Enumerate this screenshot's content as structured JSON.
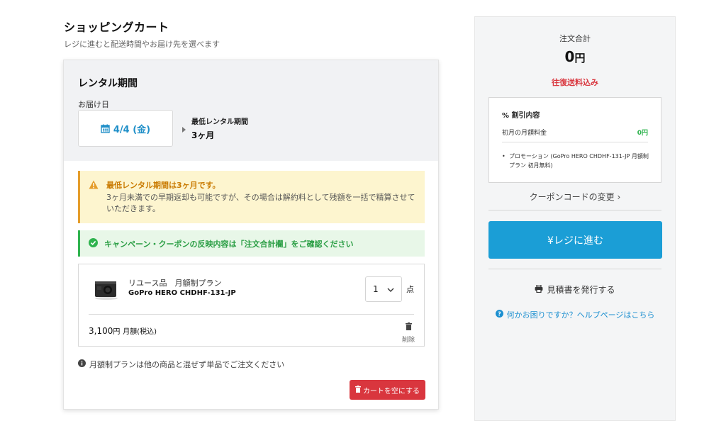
{
  "header": {
    "title": "ショッピングカート",
    "subtitle": "レジに進むと配送時間やお届け先を選べます"
  },
  "rental": {
    "title": "レンタル期間",
    "delivery_label": "お届け日",
    "delivery_date": "4/4 (金)",
    "min_period_label": "最低レンタル期間",
    "min_period_value": "3ヶ月"
  },
  "warning": {
    "title": "最低レンタル期間は3ヶ月です。",
    "body": "3ヶ月未満での早期返却も可能ですが、その場合は解約料として残額を一括で精算させていただきます。",
    "color": "#e59d2a"
  },
  "campaign": {
    "text": "キャンペーン・クーポンの反映内容は「注文合計欄」をご確認ください",
    "color": "#2fb34e"
  },
  "product": {
    "kind": "リユース品　月額制プラン",
    "name": "GoPro HERO CHDHF-131-JP",
    "quantity": "1",
    "quantity_unit": "点",
    "price": "3,100",
    "price_currency": "円",
    "price_suffix": "月額(税込)",
    "delete_label": "削除"
  },
  "notice": {
    "text": "月額制プランは他の商品と混ぜず単品でご注文ください"
  },
  "empty_cart_label": "カートを空にする",
  "summary": {
    "label": "注文合計",
    "total": "0",
    "currency": "円",
    "shipping_note": "往復送料込み",
    "discount": {
      "title": "割引内容",
      "row_label": "初月の月額料金",
      "row_value": "0円",
      "promo": "プロモーション (GoPro HERO CHDHF-131-JP 月額制プラン 初月無料)"
    },
    "coupon_link": "クーポンコードの変更",
    "checkout_label": "¥レジに進む",
    "quote_label": "見積書を発行する",
    "help_label": "何かお困りですか？ヘルプページはこちら"
  },
  "colors": {
    "accent": "#1b9ed6",
    "danger": "#d9363e",
    "success": "#2fb34e",
    "warning": "#e59d2a"
  }
}
